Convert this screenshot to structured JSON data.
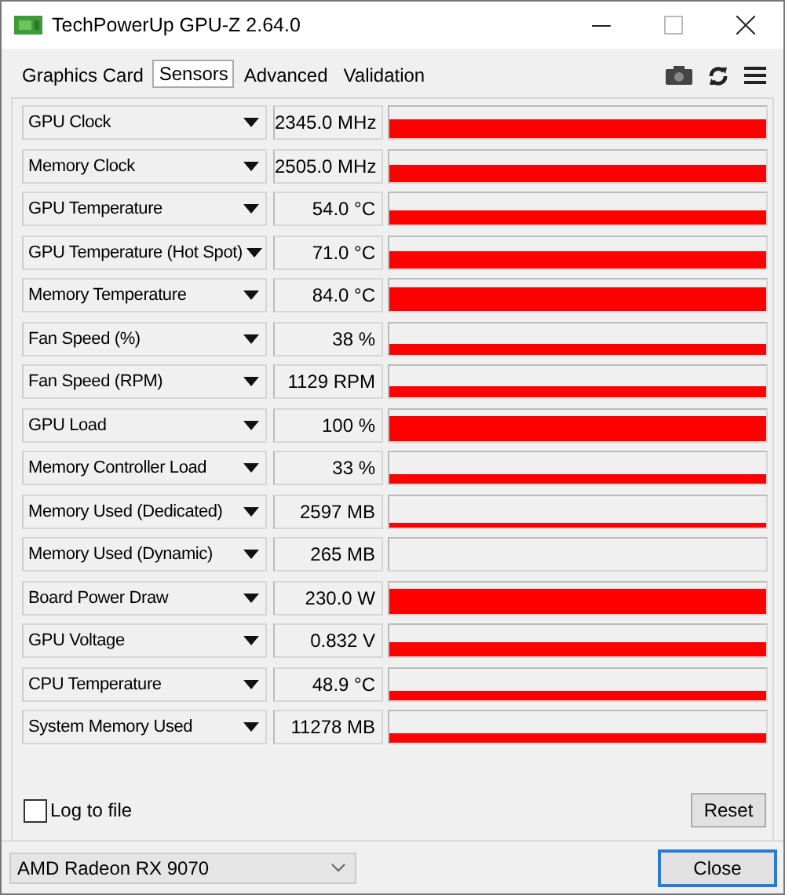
{
  "window": {
    "title": "TechPowerUp GPU-Z 2.64.0"
  },
  "tabs": [
    {
      "label": "Graphics Card",
      "selected": false
    },
    {
      "label": "Sensors",
      "selected": true
    },
    {
      "label": "Advanced",
      "selected": false
    },
    {
      "label": "Validation",
      "selected": false
    }
  ],
  "sensors": [
    {
      "name": "GPU Clock",
      "reading": "2345.0 MHz"
    },
    {
      "name": "Memory Clock",
      "reading": "2505.0 MHz"
    },
    {
      "name": "GPU Temperature",
      "reading": "54.0 °C"
    },
    {
      "name": "GPU Temperature (Hot Spot)",
      "reading": "71.0 °C"
    },
    {
      "name": "Memory Temperature",
      "reading": "84.0 °C"
    },
    {
      "name": "Fan Speed (%)",
      "reading": "38 %"
    },
    {
      "name": "Fan Speed (RPM)",
      "reading": "1129 RPM"
    },
    {
      "name": "GPU Load",
      "reading": "100 %"
    },
    {
      "name": "Memory Controller Load",
      "reading": "33 %"
    },
    {
      "name": "Memory Used (Dedicated)",
      "reading": "2597 MB"
    },
    {
      "name": "Memory Used (Dynamic)",
      "reading": "265 MB"
    },
    {
      "name": "Board Power Draw",
      "reading": "230.0 W"
    },
    {
      "name": "GPU Voltage",
      "reading": "0.832 V"
    },
    {
      "name": "CPU Temperature",
      "reading": "48.9 °C"
    },
    {
      "name": "System Memory Used",
      "reading": "11278 MB"
    }
  ],
  "log_to_file": {
    "label": "Log to file",
    "checked": false
  },
  "reset_button": "Reset",
  "gpu_select": {
    "value": "AMD Radeon RX 9070"
  },
  "close_button": "Close"
}
